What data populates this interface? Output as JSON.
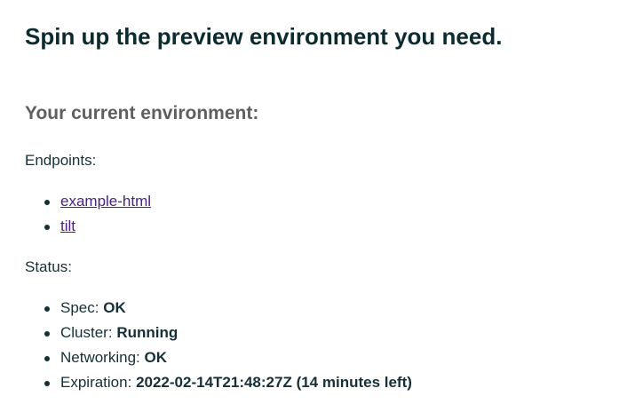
{
  "page_title": "Spin up the preview environment you need.",
  "section_title": "Your current environment:",
  "endpoints": {
    "label": "Endpoints:",
    "items": [
      "example-html",
      "tilt"
    ]
  },
  "status": {
    "label": "Status:",
    "items": [
      {
        "key": "Spec:",
        "value": "OK"
      },
      {
        "key": "Cluster:",
        "value": "Running"
      },
      {
        "key": "Networking:",
        "value": "OK"
      },
      {
        "key": "Expiration:",
        "value": "2022-02-14T21:48:27Z (14 minutes left)"
      }
    ]
  },
  "colors": {
    "heading": "#0b2b2f",
    "subheading": "#5f5f5f",
    "link": "#4b2183",
    "text": "#163038"
  }
}
